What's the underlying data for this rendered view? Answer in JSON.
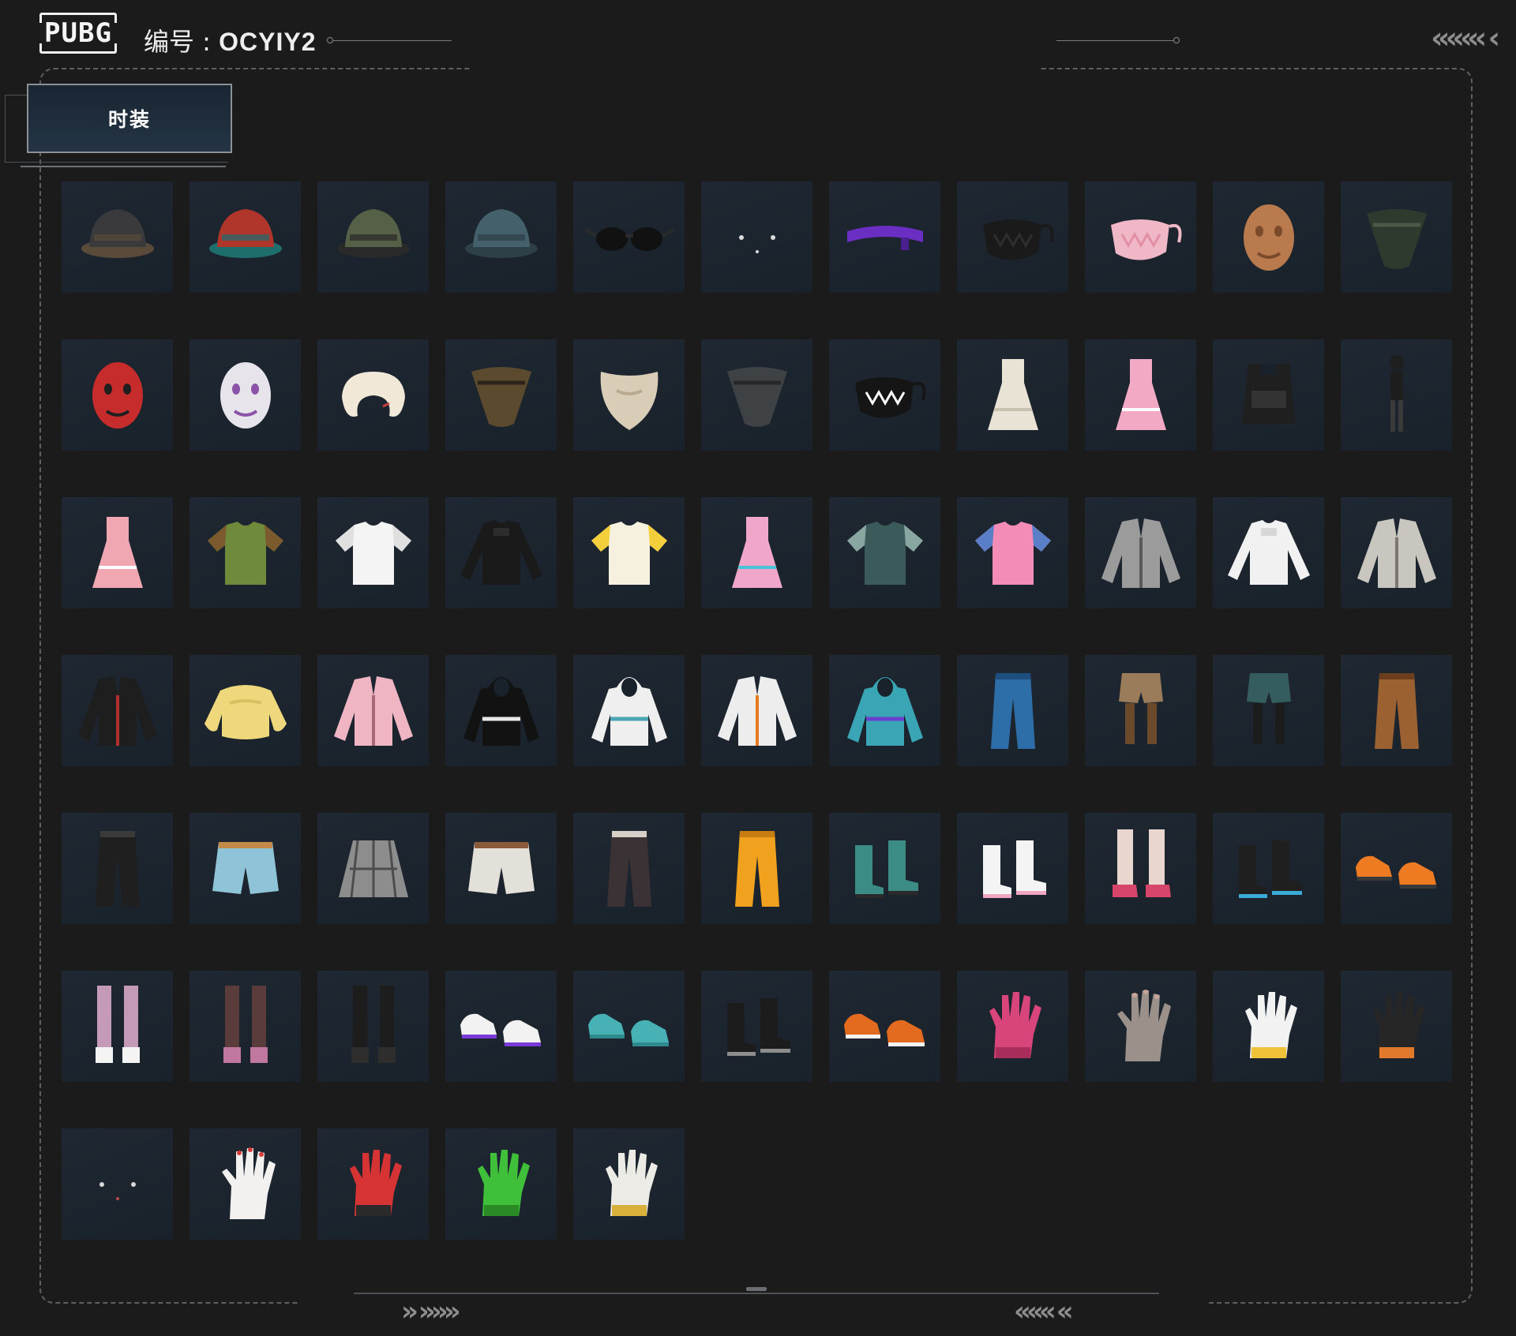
{
  "header": {
    "logo_text": "PUBG",
    "serial_label": "编号 : ",
    "serial_value": "OCYIY2",
    "right_arrows": "«««‹ ‹"
  },
  "tab": {
    "label": "时装"
  },
  "colors": {
    "background": "#1b1b1c",
    "cell_bg": "#1c252e",
    "frame_dash": "#5f5f60",
    "tab_bg": "#1f2e3d"
  },
  "items": [
    {
      "name": "black-helmet-dreadlocks",
      "icon": "hat",
      "c1": "#3a3a3c",
      "c2": "#5a4a3a"
    },
    {
      "name": "red-witch-hat-green-hair",
      "icon": "hat",
      "c1": "#b0352a",
      "c2": "#1f6e6e"
    },
    {
      "name": "army-cap-headset",
      "icon": "hat",
      "c1": "#566046",
      "c2": "#2a2a2a"
    },
    {
      "name": "bucket-hat-blue",
      "icon": "hat",
      "c1": "#44606a",
      "c2": "#2d3f47"
    },
    {
      "name": "black-sunglasses",
      "icon": "glasses",
      "c1": "#111111",
      "c2": "#2a2a2a"
    },
    {
      "name": "earrings-studs",
      "icon": "dots",
      "c1": "#dcdcdc",
      "c2": "#dcdcdc"
    },
    {
      "name": "purple-headband",
      "icon": "band",
      "c1": "#6a2fc2",
      "c2": "#4b1f90"
    },
    {
      "name": "black-face-mask",
      "icon": "mask",
      "c1": "#1a1a1a",
      "c2": "#2e2e2e"
    },
    {
      "name": "pink-face-mask",
      "icon": "mask",
      "c1": "#f0b7c6",
      "c2": "#e28fa5"
    },
    {
      "name": "wooden-doll-mask",
      "icon": "face",
      "c1": "#b97a4d",
      "c2": "#7b4a2a"
    },
    {
      "name": "camo-bandana-mask",
      "icon": "bandana",
      "c1": "#2d3a2e",
      "c2": "#4a5a48"
    },
    {
      "name": "red-oni-mask",
      "icon": "face",
      "c1": "#c72c2c",
      "c2": "#1f1f1f"
    },
    {
      "name": "clown-goggles-mask",
      "icon": "face",
      "c1": "#e8e4ec",
      "c2": "#8a52a8"
    },
    {
      "name": "neck-pillow",
      "icon": "pillow",
      "c1": "#f1e8d8",
      "c2": "#c24040"
    },
    {
      "name": "leopard-scarf",
      "icon": "bandana",
      "c1": "#5b4a2e",
      "c2": "#2c241a"
    },
    {
      "name": "white-fake-beard",
      "icon": "beard",
      "c1": "#d9cdb8",
      "c2": "#b8a990"
    },
    {
      "name": "grey-face-scarf",
      "icon": "bandana",
      "c1": "#3e4244",
      "c2": "#262829"
    },
    {
      "name": "shark-teeth-mask",
      "icon": "mask",
      "c1": "#151515",
      "c2": "#ffffff"
    },
    {
      "name": "white-ruffle-dress",
      "icon": "dress",
      "c1": "#e9e3d6",
      "c2": "#c9c1b0"
    },
    {
      "name": "pink-qipao-dress",
      "icon": "dress",
      "c1": "#f2a9c4",
      "c2": "#ffffff"
    },
    {
      "name": "tactical-vest",
      "icon": "vest",
      "c1": "#1f1f1f",
      "c2": "#333333"
    },
    {
      "name": "black-bodysuit",
      "icon": "figure",
      "c1": "#1e1e1e",
      "c2": "#3a3a3a"
    },
    {
      "name": "pink-ruffle-blouse-dress",
      "icon": "dress",
      "c1": "#f1a7b2",
      "c2": "#ffffff"
    },
    {
      "name": "green-joker-vest-suit",
      "icon": "shirt",
      "c1": "#6f8a3a",
      "c2": "#7b5a2e"
    },
    {
      "name": "white-crop-tee",
      "icon": "shirt",
      "c1": "#f4f4f4",
      "c2": "#e0e0e0"
    },
    {
      "name": "black-lace-long-sleeve",
      "icon": "longsleeve",
      "c1": "#1a1a1a",
      "c2": "#2d2d2d"
    },
    {
      "name": "yellow-chick-raglan-tee",
      "icon": "shirt",
      "c1": "#f6f1de",
      "c2": "#f2cf3b"
    },
    {
      "name": "pink-fur-holo-dress",
      "icon": "dress",
      "c1": "#f0a6c8",
      "c2": "#4ac3d6"
    },
    {
      "name": "floral-hawaiian-shirt",
      "icon": "shirt",
      "c1": "#3b5a5a",
      "c2": "#8aa6a0"
    },
    {
      "name": "pink-anime-tee",
      "icon": "shirt",
      "c1": "#f38db8",
      "c2": "#5b7ec9"
    },
    {
      "name": "silver-bomber-jacket",
      "icon": "jacket",
      "c1": "#9b9b9b",
      "c2": "#5a5a5a"
    },
    {
      "name": "white-cropped-sweater",
      "icon": "longsleeve",
      "c1": "#f1f1f1",
      "c2": "#d7d7d7"
    },
    {
      "name": "silver-jacket-open",
      "icon": "jacket",
      "c1": "#c9c6c0",
      "c2": "#7b7770"
    },
    {
      "name": "black-leather-jacket",
      "icon": "jacket",
      "c1": "#1e1e1e",
      "c2": "#b02f2f"
    },
    {
      "name": "yellow-fluffy-sweater",
      "icon": "sweater",
      "c1": "#efd77b",
      "c2": "#d8bf62"
    },
    {
      "name": "pink-graffiti-jacket",
      "icon": "jacket",
      "c1": "#efb5c2",
      "c2": "#a86878"
    },
    {
      "name": "black-checker-hoodie",
      "icon": "hoodie",
      "c1": "#121212",
      "c2": "#e8e8e8"
    },
    {
      "name": "white-hoodie-jacket",
      "icon": "hoodie",
      "c1": "#efefef",
      "c2": "#48a6b0"
    },
    {
      "name": "white-orange-tech-jacket",
      "icon": "jacket",
      "c1": "#ededed",
      "c2": "#e57a1f"
    },
    {
      "name": "blue-purple-cat-hoodie",
      "icon": "hoodie",
      "c1": "#3aa6b5",
      "c2": "#6a3ed0"
    },
    {
      "name": "blue-patched-jeans",
      "icon": "pants",
      "c1": "#2e6ea8",
      "c2": "#1d4f7e"
    },
    {
      "name": "khaki-shorts-boots",
      "icon": "shorts_legs",
      "c1": "#9a7b5a",
      "c2": "#6a4a2a"
    },
    {
      "name": "teal-shorts-leggings",
      "icon": "shorts_legs",
      "c1": "#355c5e",
      "c2": "#1c1c1c"
    },
    {
      "name": "brown-cargo-pants",
      "icon": "pants",
      "c1": "#9b6131",
      "c2": "#6b3f1d"
    },
    {
      "name": "black-studded-pants",
      "icon": "pants",
      "c1": "#1f1f1f",
      "c2": "#3a3a3a"
    },
    {
      "name": "light-blue-denim-shorts",
      "icon": "shorts",
      "c1": "#8fc4d8",
      "c2": "#c48a4a"
    },
    {
      "name": "plaid-pleated-skirt",
      "icon": "skirt",
      "c1": "#8d8d8d",
      "c2": "#4d4d4d"
    },
    {
      "name": "white-denim-shorts",
      "icon": "shorts",
      "c1": "#e3e0da",
      "c2": "#8a5a3a"
    },
    {
      "name": "camo-pants",
      "icon": "pants",
      "c1": "#3a3234",
      "c2": "#d7d0c8"
    },
    {
      "name": "orange-jogger-pants",
      "icon": "pants",
      "c1": "#f0a21e",
      "c2": "#c67c0f"
    },
    {
      "name": "teal-combat-boots",
      "icon": "boots",
      "c1": "#3b8c84",
      "c2": "#2a2a2a"
    },
    {
      "name": "white-pink-boots",
      "icon": "boots",
      "c1": "#f4f4f4",
      "c2": "#f0a6c0"
    },
    {
      "name": "pink-mary-jane-shoes",
      "icon": "heels",
      "c1": "#d8456a",
      "c2": "#e9d7cf"
    },
    {
      "name": "black-legwarmers-blue-shoes",
      "icon": "boots",
      "c1": "#1f1f1f",
      "c2": "#3aaad8"
    },
    {
      "name": "orange-sneakers",
      "icon": "sneakers",
      "c1": "#ee7a22",
      "c2": "#3a3a3a"
    },
    {
      "name": "pink-stockings-white-boots",
      "icon": "stockings",
      "c1": "#c59ab8",
      "c2": "#f4f4f4"
    },
    {
      "name": "brown-stockings-pink-boots",
      "icon": "stockings",
      "c1": "#5a3d3b",
      "c2": "#c077a0"
    },
    {
      "name": "black-thigh-stockings",
      "icon": "stockings",
      "c1": "#1d1d1d",
      "c2": "#2e2e2e"
    },
    {
      "name": "white-purple-sneakers",
      "icon": "sneakers",
      "c1": "#f2f2f2",
      "c2": "#7a3ad8"
    },
    {
      "name": "teal-clogs",
      "icon": "sneakers",
      "c1": "#48b1b6",
      "c2": "#2f8a8e"
    },
    {
      "name": "fur-lined-black-boots",
      "icon": "boots",
      "c1": "#1c1c1c",
      "c2": "#8d8d8d"
    },
    {
      "name": "orange-high-tops",
      "icon": "sneakers",
      "c1": "#e26b1f",
      "c2": "#f2f2f2"
    },
    {
      "name": "pink-fingerless-gloves",
      "icon": "glove",
      "c1": "#d8457a",
      "c2": "#a82d5a"
    },
    {
      "name": "bare-hand-nails",
      "icon": "hand",
      "c1": "#9b918a",
      "c2": "#c8a49a"
    },
    {
      "name": "white-gold-racing-gloves",
      "icon": "glove",
      "c1": "#f2f2f2",
      "c2": "#f0c23a"
    },
    {
      "name": "black-orange-gloves",
      "icon": "glove",
      "c1": "#262626",
      "c2": "#e07a2a"
    },
    {
      "name": "nail-piercing-set",
      "icon": "dots",
      "c1": "#d8d8d8",
      "c2": "#c24a4a"
    },
    {
      "name": "white-hand-red-nails",
      "icon": "hand",
      "c1": "#f3f1ef",
      "c2": "#d83a3a"
    },
    {
      "name": "red-fighter-gloves",
      "icon": "glove",
      "c1": "#d63434",
      "c2": "#2a2a2a"
    },
    {
      "name": "green-rubber-gloves",
      "icon": "glove",
      "c1": "#3fbf3a",
      "c2": "#2a8a24"
    },
    {
      "name": "white-work-gloves",
      "icon": "glove",
      "c1": "#ecebe6",
      "c2": "#d9b13a"
    }
  ],
  "bottom": {
    "left_arrows": "» »»»",
    "right_arrows": "««« «"
  }
}
